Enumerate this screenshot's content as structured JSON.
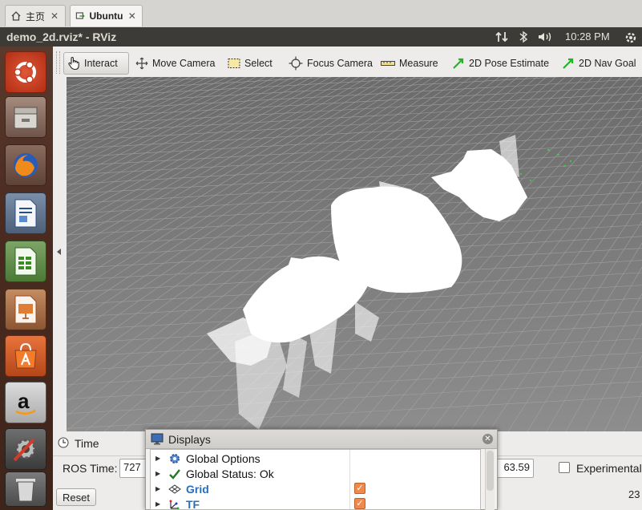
{
  "browser": {
    "tabs": [
      {
        "label": "主页",
        "icon": "home-icon"
      },
      {
        "label": "Ubuntu",
        "icon": "vm-icon"
      }
    ]
  },
  "window": {
    "title": "demo_2d.rviz* - RViz",
    "clock": "10:28 PM"
  },
  "launcher": {
    "apps": [
      "ubuntu-dash",
      "files",
      "firefox",
      "libreoffice-writer",
      "libreoffice-calc",
      "libreoffice-impress",
      "software-center",
      "amazon",
      "system-settings"
    ]
  },
  "toolbar": {
    "tools": [
      {
        "label": "Interact",
        "icon": "hand-cursor-icon",
        "active": true
      },
      {
        "label": "Move Camera",
        "icon": "move-camera-icon"
      },
      {
        "label": "Select",
        "icon": "select-rect-icon"
      },
      {
        "label": "Focus Camera",
        "icon": "focus-crosshair-icon"
      },
      {
        "label": "Measure",
        "icon": "ruler-icon"
      },
      {
        "label": "2D Pose Estimate",
        "icon": "green-arrow-icon"
      },
      {
        "label": "2D Nav Goal",
        "icon": "green-arrow-icon"
      }
    ]
  },
  "time_panel": {
    "title": "Time",
    "ros_time_label": "ROS Time:",
    "ros_time_value": "727",
    "elapsed_value": "63.59",
    "experimental_label": "Experimental",
    "reset_label": "Reset",
    "fps_partial": "23"
  },
  "displays": {
    "title": "Displays",
    "items": [
      {
        "label": "Global Options",
        "icon": "gear-icon",
        "checkbox": false
      },
      {
        "label": "Global Status: Ok",
        "icon": "check-icon",
        "checkbox": false
      },
      {
        "label": "Grid",
        "icon": "grid-icon",
        "checkbox": true,
        "highlight": true
      },
      {
        "label": "TF",
        "icon": "tf-icon",
        "checkbox": true,
        "highlight": true
      }
    ]
  },
  "colors": {
    "accent_orange": "#f08a4b",
    "link_blue": "#2a6ebb",
    "launcher_bg": "#4b2b20",
    "viewport_bg": "#303030"
  }
}
